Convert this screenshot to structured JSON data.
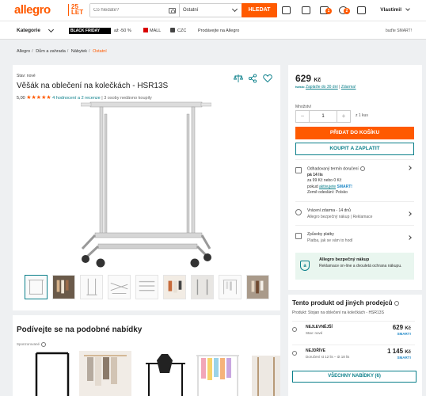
{
  "header": {
    "logo": "allegro",
    "anniversary": "25 LET",
    "search_placeholder": "Co hledáte?",
    "category": "Ostatní",
    "search_button": "HLEDAT",
    "user": "Vlastimil",
    "badges": [
      "1",
      "2"
    ]
  },
  "menu": {
    "categories": "Kategorie",
    "black_friday": "BLACK FRIDAY",
    "bf_discount": "až -50 %",
    "mall": "MALL",
    "czc": "CZC",
    "sell": "Prodávejte na Allegro",
    "smart": "buďte SMART!"
  },
  "breadcrumb": [
    "Allegro",
    "Dům a zahrada",
    "Nábytek",
    "Ostatní"
  ],
  "product": {
    "condition": "Stav: nové",
    "title": "Věšák na oblečení na kolečkách - HSR13S",
    "rating_value": "5,00",
    "stars": "★★★★★",
    "reviews": "4 hodnocení a 2 recenze",
    "bought": "3 osoby nedávno koupily"
  },
  "thumbnails": [
    "rack-front",
    "rack-clothes",
    "rack-side",
    "rack-flat",
    "rack-parts",
    "rack-room",
    "rack-detail",
    "rack-white",
    "rack-interior"
  ],
  "purchase": {
    "price_main": "629",
    "price_currency": "Kč",
    "pay_later": "Zaplaťte do 30 dní",
    "pay_later_free": "Zdarma!",
    "qty_label": "Množství",
    "qty_value": "1",
    "qty_minus": "−",
    "qty_plus": "+",
    "per_unit": "z 1 kus",
    "add_to_cart": "PŘIDAT DO KOŠÍKU",
    "buy_now": "KOUPIT A ZAPLATIT",
    "delivery_title": "Odhadovaný termín doručení",
    "delivery_date": "pá 14 lis",
    "delivery_price": "za 99 Kč nebo 0 Kč",
    "delivery_smart_prefix": "pokud",
    "delivery_smart_link": "aktivujete",
    "delivery_smart_brand": "SMART!",
    "delivery_origin": "Země odeslání: Polsko",
    "returns_title": "Vrácení zdarma - 14 dnů",
    "returns_desc": "Allegro bezpečný nákup | Reklamace",
    "payment_title": "Způsoby platby",
    "payment_desc": "Platba, jak se vám to hodí",
    "safe_title": "Allegro bezpečný nákup",
    "safe_desc": "Reklamace on-line a dvouletá ochrana nákupu."
  },
  "similar": {
    "title": "Podívejte se na podobné nabídky",
    "sponsored": "Sponzorované"
  },
  "others": {
    "title": "Tento produkt od jiných prodejců",
    "product_line": "Produkt: Stojan na oblečení na kolečkách - HSR13S",
    "offers": [
      {
        "tag": "NEJLEVNĚJŠÍ",
        "meta": "Stav: nové",
        "price": "629",
        "currency": "Kč",
        "smart": "SMART!"
      },
      {
        "tag": "NEJDŘÍVE",
        "meta": "Doručení st 12 lis – út 18 lis",
        "price": "1 145",
        "currency": "Kč",
        "smart": "SMART!"
      }
    ],
    "all_offers": "VŠECHNY NABÍDKY (6)"
  }
}
